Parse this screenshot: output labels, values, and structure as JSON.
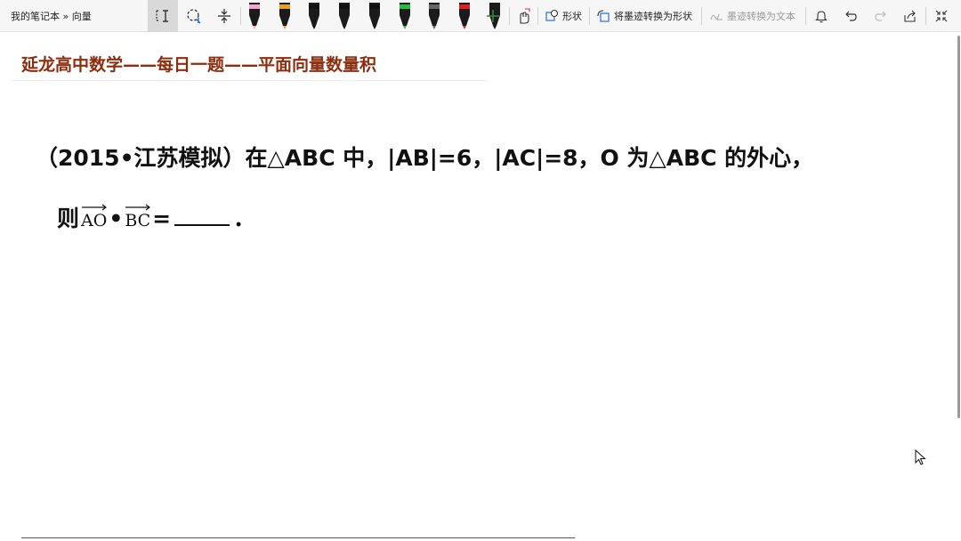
{
  "toolbar": {
    "breadcrumb": "我的笔记本 » 向量",
    "shapes_label": "形状",
    "ink_to_shape_label": "将墨迹转换为形状",
    "ink_to_text_label": "墨迹转换为文本",
    "pens": [
      {
        "name": "highlighter-pen-pink",
        "color": "#f2a7c9"
      },
      {
        "name": "pen-rainbow",
        "color": "#e8a020"
      },
      {
        "name": "pen-black-1",
        "color": "#111111"
      },
      {
        "name": "pen-black-2",
        "color": "#111111"
      },
      {
        "name": "pen-black-3",
        "color": "#111111"
      },
      {
        "name": "highlighter-green",
        "color": "#22c03a"
      },
      {
        "name": "pen-gray",
        "color": "#666666"
      },
      {
        "name": "pen-red",
        "color": "#e02020"
      },
      {
        "name": "pen-galaxy",
        "color": "#1b1b1b"
      }
    ]
  },
  "page": {
    "title": "延龙高中数学——每日一题——平面向量数量积",
    "question": "（2015•江苏模拟）在△ABC 中，|AB|=6，|AC|=8，O 为△ABC 的外心，",
    "answer_prefix": "则",
    "vec1": "AO",
    "dot": "•",
    "vec2": "BC",
    "equals": "=",
    "period": "．"
  }
}
